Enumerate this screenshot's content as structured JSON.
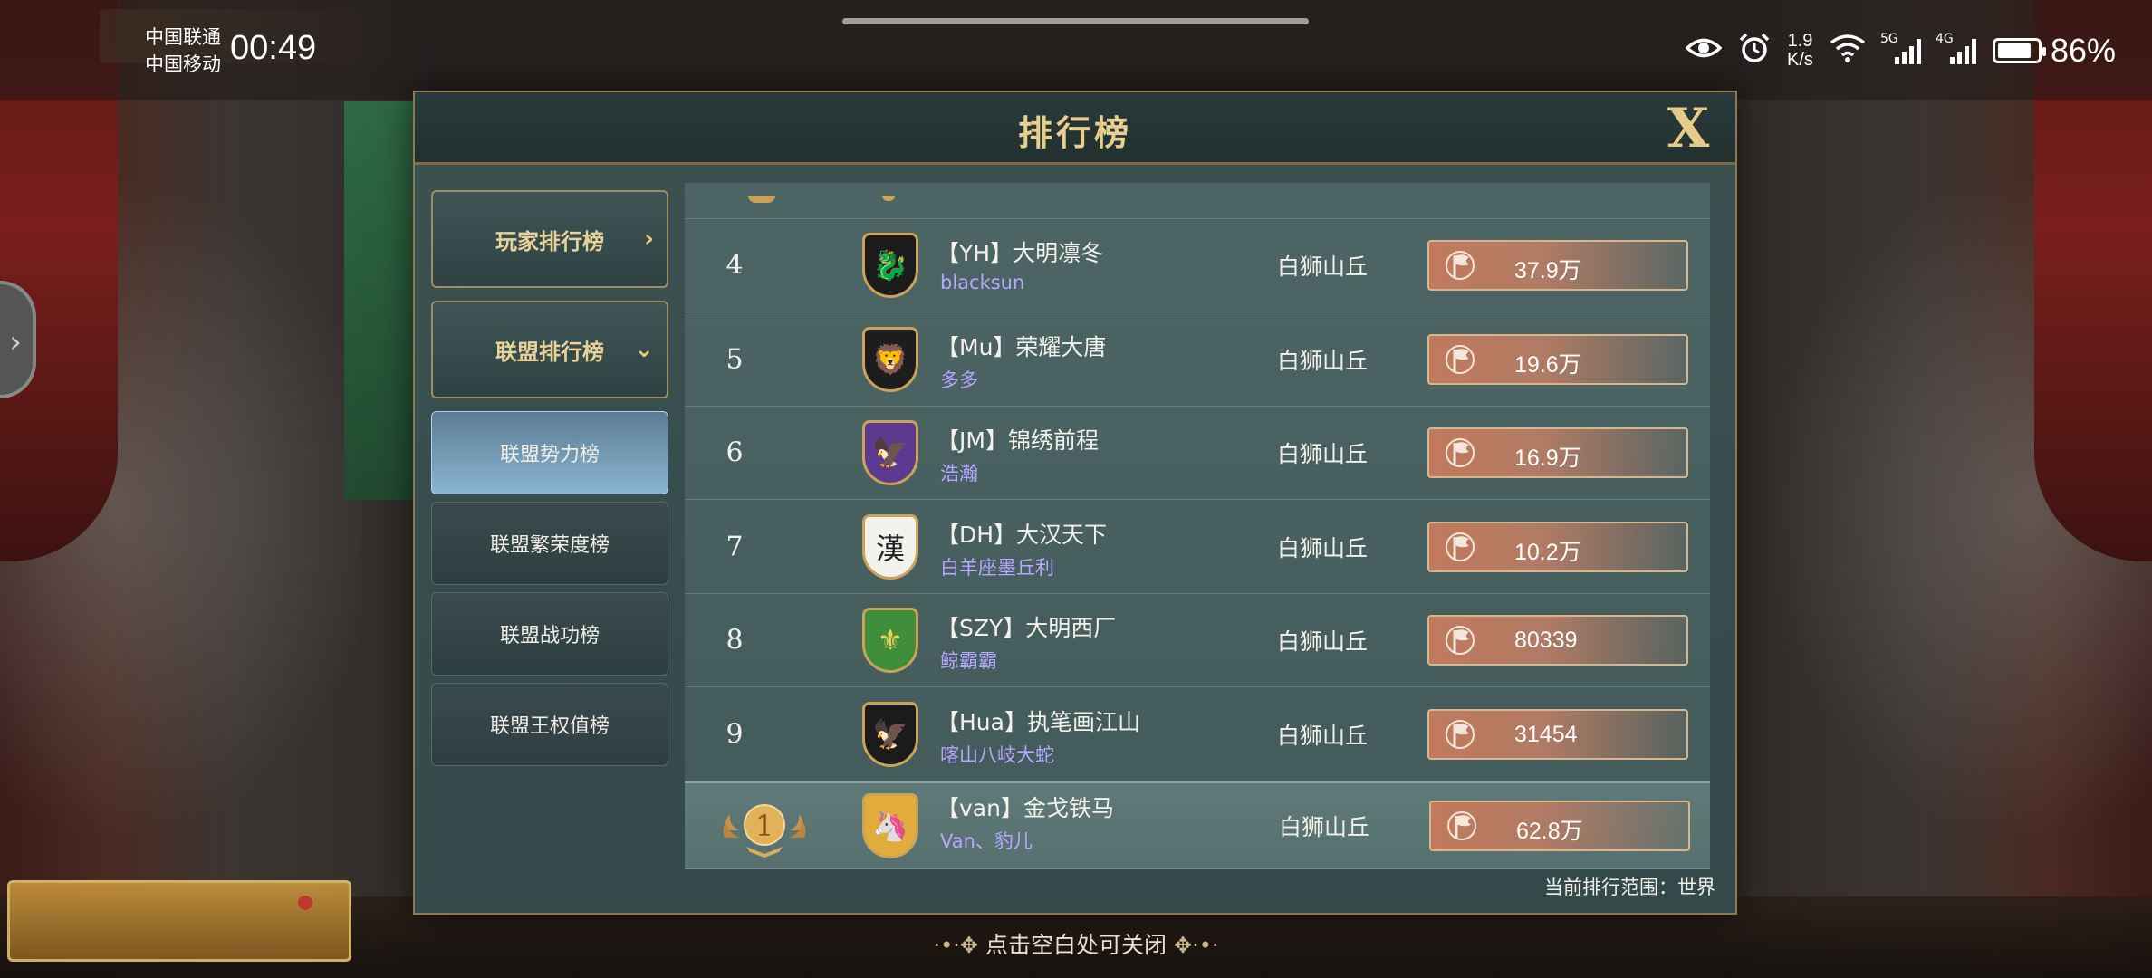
{
  "status_bar": {
    "carrier_1": "中国联通",
    "carrier_2": "中国移动",
    "time": "00:49",
    "net_speed_value": "1.9",
    "net_speed_unit": "K/s",
    "sig1_tag": "5G",
    "sig2_tag": "4G",
    "battery_percent": "86%",
    "battery_level": 0.86
  },
  "modal": {
    "title": "排行榜",
    "close_label": "X",
    "scope_text": "当前排行范围：世界",
    "hint": "点击空白处可关闭"
  },
  "menu": {
    "player_rank": "玩家排行榜",
    "alliance_rank": "联盟排行榜",
    "sub_items": [
      {
        "label": "联盟势力榜"
      },
      {
        "label": "联盟繁荣度榜"
      },
      {
        "label": "联盟战功榜"
      },
      {
        "label": "联盟王权值榜"
      }
    ]
  },
  "rows": [
    {
      "rank": "4",
      "alliance": "【YH】大明凛冬",
      "leader": "blacksun",
      "server": "白狮山丘",
      "power": "37.9万",
      "shield_color": "#1b1b1b",
      "crest": "🐉",
      "crest_color": "#c0352b"
    },
    {
      "rank": "5",
      "alliance": "【Mu】荣耀大唐",
      "leader": "多多",
      "server": "白狮山丘",
      "power": "19.6万",
      "shield_color": "#1d1d1d",
      "crest": "🦁",
      "crest_color": "#d6a43e"
    },
    {
      "rank": "6",
      "alliance": "【JM】锦绣前程",
      "leader": "浩瀚",
      "server": "白狮山丘",
      "power": "16.9万",
      "shield_color": "#5b3a8f",
      "crest": "🦅",
      "crest_color": "#e7c26a"
    },
    {
      "rank": "7",
      "alliance": "【DH】大汉天下",
      "leader": "白羊座墨丘利",
      "server": "白狮山丘",
      "power": "10.2万",
      "shield_color": "#f1f1ee",
      "crest": "漢",
      "crest_color": "#222222"
    },
    {
      "rank": "8",
      "alliance": "【SZY】大明西厂",
      "leader": "鲸霸霸",
      "server": "白狮山丘",
      "power": "80339",
      "shield_color": "#3f8f3a",
      "crest": "⚜",
      "crest_color": "#f1d05a"
    },
    {
      "rank": "9",
      "alliance": "【Hua】执笔画江山",
      "leader": "喀山八岐大蛇",
      "server": "白狮山丘",
      "power": "31454",
      "shield_color": "#1b1b1b",
      "crest": "🦅",
      "crest_color": "#f4f4f4"
    }
  ],
  "my_row": {
    "rank": "1",
    "alliance": "【van】金戈铁马",
    "leader": "Van、豹儿",
    "server": "白狮山丘",
    "power": "62.8万",
    "shield_color": "#e2ac3c",
    "crest": "🦄",
    "crest_color": "#ffffff"
  }
}
